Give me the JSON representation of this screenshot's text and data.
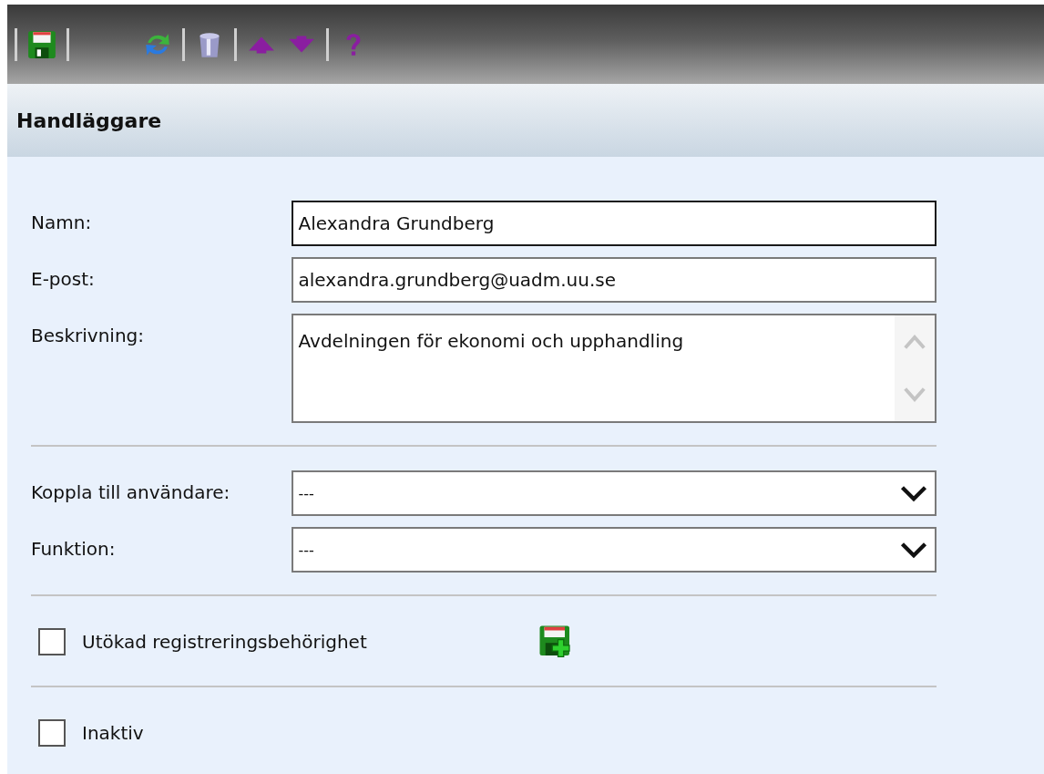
{
  "header": {
    "title": "Handläggare"
  },
  "sections": [
    {
      "fields": [
        {
          "label": "Namn:",
          "kind": "text",
          "value": "Alexandra Grundberg",
          "focused": true
        },
        {
          "label": "E-post:",
          "kind": "text",
          "value": "alexandra.grundberg@uadm.uu.se",
          "focused": false
        },
        {
          "label": "Beskrivning:",
          "kind": "textarea",
          "value": "Avdelningen för ekonomi och upphandling",
          "focused": false
        }
      ]
    },
    {
      "fields": [
        {
          "label": "Koppla till användare:",
          "kind": "select",
          "value": "---",
          "focused": false
        },
        {
          "label": "Funktion:",
          "kind": "select",
          "value": "---",
          "focused": false
        }
      ]
    },
    {
      "checkbox": {
        "label": "Utökad registreringsbehörighet",
        "checked": false,
        "kind": "with-add"
      }
    },
    {
      "checkbox": {
        "label": "Inaktiv",
        "checked": false,
        "kind": "plain"
      }
    }
  ]
}
